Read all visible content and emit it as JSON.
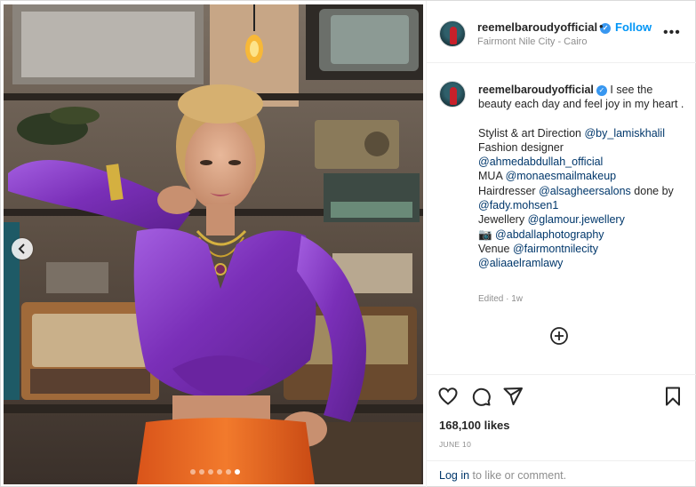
{
  "post": {
    "username": "reemelbaroudyofficial",
    "separator": "•",
    "follow_label": "Follow",
    "location": "Fairmont Nile City - Cairo",
    "more_label": "•••"
  },
  "caption": {
    "username": "reemelbaroudyofficial",
    "text_first": "I see the beauty each day and feel joy in my heart .",
    "l1_prefix": "Stylist & art Direction ",
    "l1_mention": "@by_lamiskhalil",
    "l2_text": "Fashion designer",
    "l3_mention": "@ahmedabdullah_official",
    "l4_prefix": "MUA ",
    "l4_mention": "@monaesmailmakeup",
    "l5_prefix": "Hairdresser ",
    "l5_mention": "@alsagheersalons",
    "l5_suffix": " done by",
    "l6_mention": "@fady.mohsen1",
    "l7_prefix": "Jewellery ",
    "l7_mention": "@glamour.jewellery",
    "l8_prefix": "📷 ",
    "l8_mention": "@abdallaphotography",
    "l9_prefix": "Venue ",
    "l9_mention": "@fairmontnilecity",
    "l10_mention": "@aliaaelramlawy",
    "edited": "Edited · 1w"
  },
  "stats": {
    "likes": "168,100 likes",
    "date": "JUNE 10"
  },
  "login": {
    "link": "Log in",
    "rest": " to like or comment."
  },
  "carousel": {
    "total_slides": 6,
    "active_slide": 6
  },
  "colors": {
    "accent": "#0095f6",
    "mention": "#00376b",
    "muted": "#8e8e8e",
    "top_purple": "#8a3cc8",
    "skirt_orange": "#e8661c"
  },
  "icons": {
    "prev": "chevron-left-icon",
    "add_comment": "plus-circle-icon",
    "like": "heart-icon",
    "comment": "comment-icon",
    "share": "send-icon",
    "save": "bookmark-icon"
  }
}
